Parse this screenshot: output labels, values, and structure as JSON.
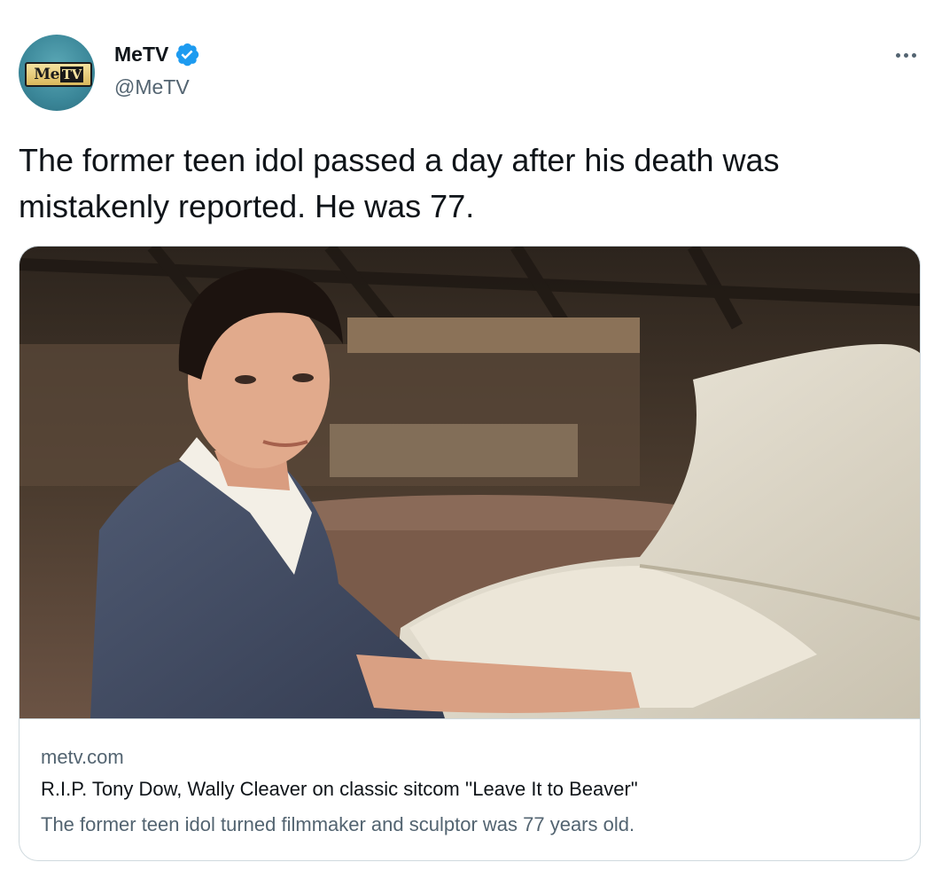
{
  "tweet": {
    "author": {
      "name": "MeTV",
      "handle": "@MeTV",
      "verified": true,
      "avatar_logo": "MeTV"
    },
    "text": "The former teen idol passed a day after his death was mistakenly reported. He was 77.",
    "more_icon": "more-horizontal-icon"
  },
  "card": {
    "domain": "metv.com",
    "title": "R.I.P. Tony Dow, Wally Cleaver on classic sitcom ''Leave It to Beaver\"",
    "description": "The former teen idol turned filmmaker and sculptor was 77 years old."
  },
  "colors": {
    "verified_blue": "#1d9bf0",
    "text_primary": "#0f1419",
    "text_secondary": "#536471",
    "border": "#cfd9de"
  }
}
